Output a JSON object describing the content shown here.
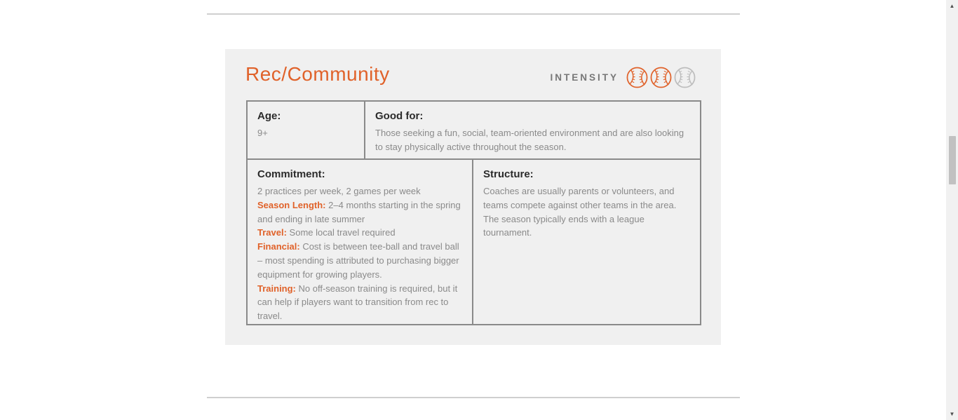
{
  "card": {
    "title": "Rec/Community",
    "intensity_label": "INTENSITY",
    "intensity": {
      "level": 2,
      "max": 3,
      "active_color": "#e0622a",
      "inactive_color": "#bdbdbd"
    },
    "accent_color": "#e0622a"
  },
  "age": {
    "heading": "Age:",
    "value": "9+"
  },
  "good_for": {
    "heading": "Good for:",
    "text": "Those seeking a fun, social, team-oriented environment and are also looking to stay physically active throughout the season."
  },
  "commitment": {
    "heading": "Commitment:",
    "summary": "2 practices per week, 2 games per week",
    "items": [
      {
        "label": "Season Length:",
        "text": "2–4 months starting in the spring and ending in late summer"
      },
      {
        "label": "Travel:",
        "text": "Some local travel required"
      },
      {
        "label": "Financial:",
        "text": "Cost is between tee-ball and travel ball – most spending is attributed to purchasing bigger equipment for growing players."
      },
      {
        "label": "Training:",
        "text": "No off-season training is required, but it can help if players want to transition from rec to travel."
      }
    ]
  },
  "structure": {
    "heading": "Structure:",
    "text": "Coaches are usually parents or volunteers, and teams compete against other teams in the area. The season typically ends with a league tournament."
  },
  "icons": {
    "baseball": "baseball-icon",
    "scroll_up": "scroll-up-icon",
    "scroll_down": "scroll-down-icon"
  },
  "scrollbar": {
    "up_glyph": "▲",
    "down_glyph": "▼",
    "scroll_position": 0.38
  }
}
